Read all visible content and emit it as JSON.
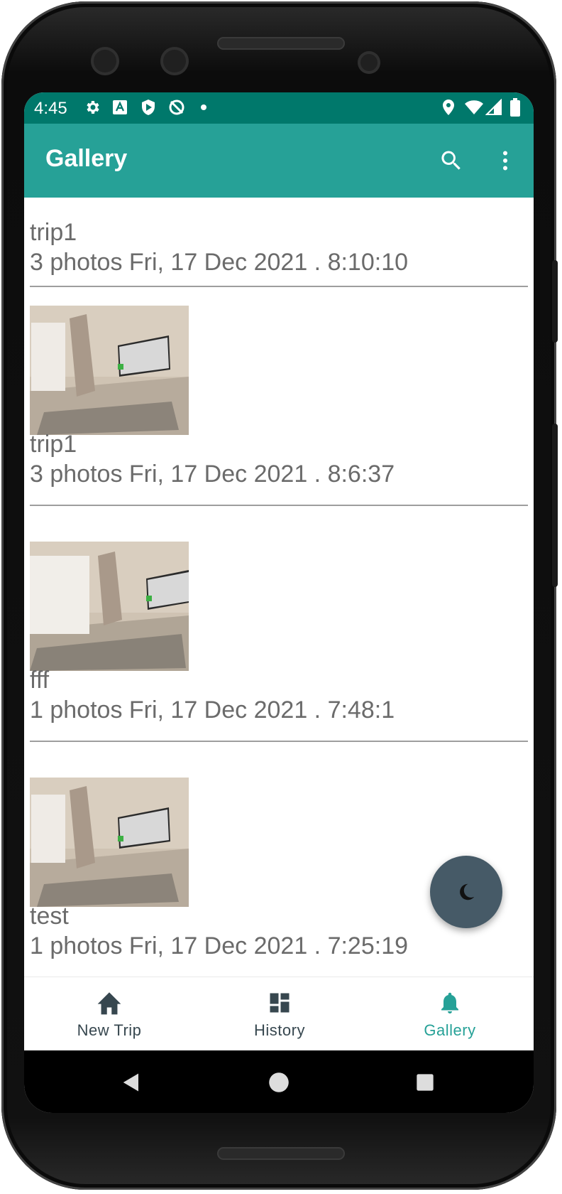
{
  "status_bar": {
    "time": "4:45"
  },
  "app_bar": {
    "title": "Gallery"
  },
  "trips": [
    {
      "title": "trip1",
      "subtitle": "3 photos Fri, 17 Dec 2021 . 8:10:10"
    },
    {
      "title": "trip1",
      "subtitle": "3 photos Fri, 17 Dec 2021 . 8:6:37"
    },
    {
      "title": "fff",
      "subtitle": "1 photos Fri, 17 Dec 2021 . 7:48:1"
    },
    {
      "title": "test",
      "subtitle": "1 photos Fri, 17 Dec 2021 . 7:25:19"
    }
  ],
  "bottom_nav": {
    "items": [
      {
        "label": "New Trip",
        "icon": "home-icon",
        "active": false
      },
      {
        "label": "History",
        "icon": "dashboard-icon",
        "active": false
      },
      {
        "label": "Gallery",
        "icon": "bell-icon",
        "active": true
      }
    ]
  },
  "colors": {
    "status_bar": "#00786b",
    "app_bar": "#26a197",
    "accent": "#26a197",
    "fab": "#465a67",
    "text_secondary": "#6b6b6b"
  }
}
